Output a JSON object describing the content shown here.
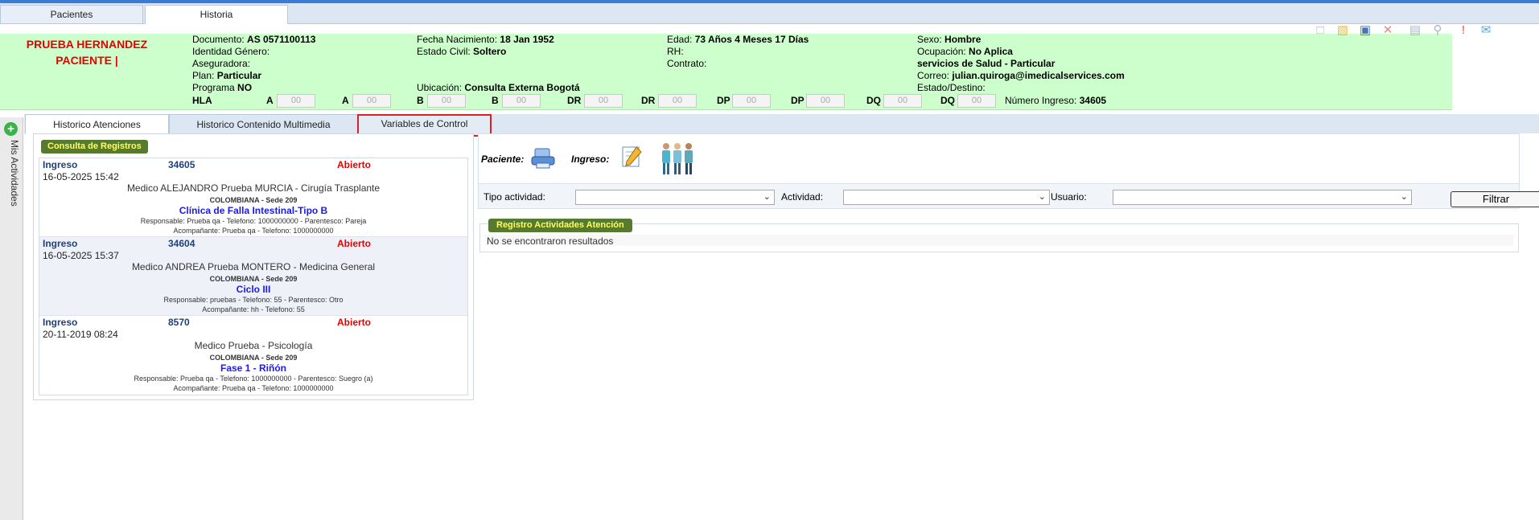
{
  "top_tabs": [
    "Pacientes",
    "Historia"
  ],
  "side": {
    "label": "Mis Actividades"
  },
  "patient": {
    "name_line1": "PRUEBA HERNANDEZ",
    "name_line2": "PACIENTE |",
    "documento_label": "Documento:",
    "documento": "AS 0571100113",
    "identidad_label": "Identidad Género:",
    "aseguradora_label": "Aseguradora:",
    "plan_label": "Plan:",
    "plan": "Particular",
    "programa_label": "Programa",
    "programa": "NO",
    "fecha_label": "Fecha Nacimiento:",
    "fecha": "18 Jan 1952",
    "civil_label": "Estado Civil:",
    "civil": "Soltero",
    "ubicacion_label": "Ubicación:",
    "ubicacion": "Consulta Externa Bogotá",
    "edad_label": "Edad:",
    "edad": "73 Años 4 Meses 17 Días",
    "rh_label": "RH:",
    "contrato_label": "Contrato:",
    "sexo_label": "Sexo:",
    "sexo": "Hombre",
    "ocupacion_label": "Ocupación:",
    "ocupacion": "No Aplica",
    "servicios": "servicios de Salud - Particular",
    "correo_label": "Correo:",
    "correo": "julian.quiroga@imedicalservices.com",
    "estado_label": "Estado/Destino:",
    "hla_label": "HLA",
    "hla_fields": [
      "A",
      "A",
      "B",
      "B",
      "DR",
      "DR",
      "DP",
      "DP",
      "DQ",
      "DQ"
    ],
    "hla_placeholder": "00",
    "ingreso_label": "Número Ingreso:",
    "ingreso": "34605"
  },
  "toolbar_icons": [
    "new-document-icon",
    "folder-icon",
    "save-icon",
    "delete-icon",
    "print-icon",
    "preview-icon",
    "alert-icon",
    "comment-icon"
  ],
  "tabs": [
    "Historico Atenciones",
    "Historico Contenido Multimedia",
    "Variables de Control"
  ],
  "consulta": {
    "title": "Consulta de Registros",
    "records": [
      {
        "label": "Ingreso",
        "number": "34605",
        "status": "Abierto",
        "date": "16-05-2025 15:42",
        "medico": "Medico ALEJANDRO Prueba MURCIA - Cirugía Trasplante",
        "sede": "COLOMBIANA - Sede 209",
        "programa": "Clínica de Falla Intestinal-Tipo B",
        "responsable": "Responsable: Prueba qa - Telefono: 1000000000 - Parentesco: Pareja",
        "acompanante": "Acompañante: Prueba qa - Telefono: 1000000000"
      },
      {
        "label": "Ingreso",
        "number": "34604",
        "status": "Abierto",
        "date": "16-05-2025 15:37",
        "medico": "Medico ANDREA Prueba MONTERO - Medicina General",
        "sede": "COLOMBIANA - Sede 209",
        "programa": "Ciclo III",
        "responsable": "Responsable: pruebas - Telefono: 55 - Parentesco: Otro",
        "acompanante": "Acompañante: hh - Telefono: 55"
      },
      {
        "label": "Ingreso",
        "number": "8570",
        "status": "Abierto",
        "date": "20-11-2019 08:24",
        "medico": "Medico Prueba - Psicología",
        "sede": "COLOMBIANA - Sede 209",
        "programa": "Fase 1 - Riñón",
        "responsable": "Responsable: Prueba qa - Telefono: 1000000000 - Parentesco: Suegro (a)",
        "acompanante": "Acompañante: Prueba qa - Telefono: 1000000000"
      }
    ]
  },
  "right": {
    "paciente_label": "Paciente:",
    "ingreso_label": "Ingreso:",
    "tipo_label": "Tipo actividad:",
    "actividad_label": "Actividad:",
    "usuario_label": "Usuario:",
    "filter_button": "Filtrar",
    "registro_title": "Registro Actividades Atención",
    "empty_message": "No se encontraron resultados"
  }
}
